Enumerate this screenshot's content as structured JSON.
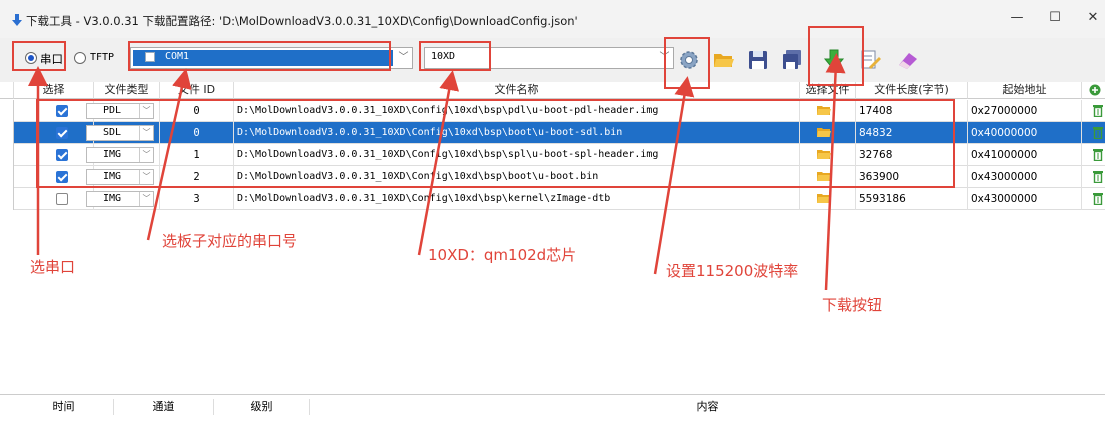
{
  "window": {
    "title": "下载工具 - V3.0.0.31   下载配置路径: 'D:\\MolDownloadV3.0.0.31_10XD\\Config\\DownloadConfig.json'",
    "controls": [
      "—",
      "☐",
      "✕"
    ]
  },
  "toolbar": {
    "mode_serial": "串口",
    "mode_tftp": "TFTP",
    "port_value": "COM1",
    "chip_value": "10XD",
    "icons": [
      "settings-gear-icon",
      "open-folder-icon",
      "save-icon",
      "save-as-icon",
      "download-arrow-icon",
      "edit-note-icon",
      "eraser-icon"
    ]
  },
  "grid": {
    "headers": [
      "选择",
      "文件类型",
      "文件 ID",
      "文件名称",
      "选择文件",
      "文件长度(字节)",
      "起始地址"
    ],
    "rows": [
      {
        "checked": true,
        "type": "PDL",
        "id": "0",
        "name": "D:\\MolDownloadV3.0.0.31_10XD\\Config\\10xd\\bsp\\pdl\\u-boot-pdl-header.img",
        "length": "17408",
        "address": "0x27000000",
        "selected": false
      },
      {
        "checked": true,
        "type": "SDL",
        "id": "0",
        "name": "D:\\MolDownloadV3.0.0.31_10XD\\Config\\10xd\\bsp\\boot\\u-boot-sdl.bin",
        "length": "84832",
        "address": "0x40000000",
        "selected": true
      },
      {
        "checked": true,
        "type": "IMG",
        "id": "1",
        "name": "D:\\MolDownloadV3.0.0.31_10XD\\Config\\10xd\\bsp\\spl\\u-boot-spl-header.img",
        "length": "32768",
        "address": "0x41000000",
        "selected": false
      },
      {
        "checked": true,
        "type": "IMG",
        "id": "2",
        "name": "D:\\MolDownloadV3.0.0.31_10XD\\Config\\10xd\\bsp\\boot\\u-boot.bin",
        "length": "363900",
        "address": "0x43000000",
        "selected": false
      },
      {
        "checked": false,
        "type": "IMG",
        "id": "3",
        "name": "D:\\MolDownloadV3.0.0.31_10XD\\Config\\10xd\\bsp\\kernel\\zImage-dtb",
        "length": "5593186",
        "address": "0x43000000",
        "selected": false
      }
    ]
  },
  "log": {
    "headers": [
      "时间",
      "通道",
      "级别",
      "内容"
    ]
  },
  "annotations": {
    "select_serial": "选串口",
    "select_port": "选板子对应的串口号",
    "chip": "10XD：qm102d芯片",
    "baud": "设置115200波特率",
    "download": "下载按钮"
  },
  "colors": {
    "selection": "#1f6fc8",
    "annotation_red": "#e0443a",
    "checkbox_blue": "#2a73d6"
  }
}
